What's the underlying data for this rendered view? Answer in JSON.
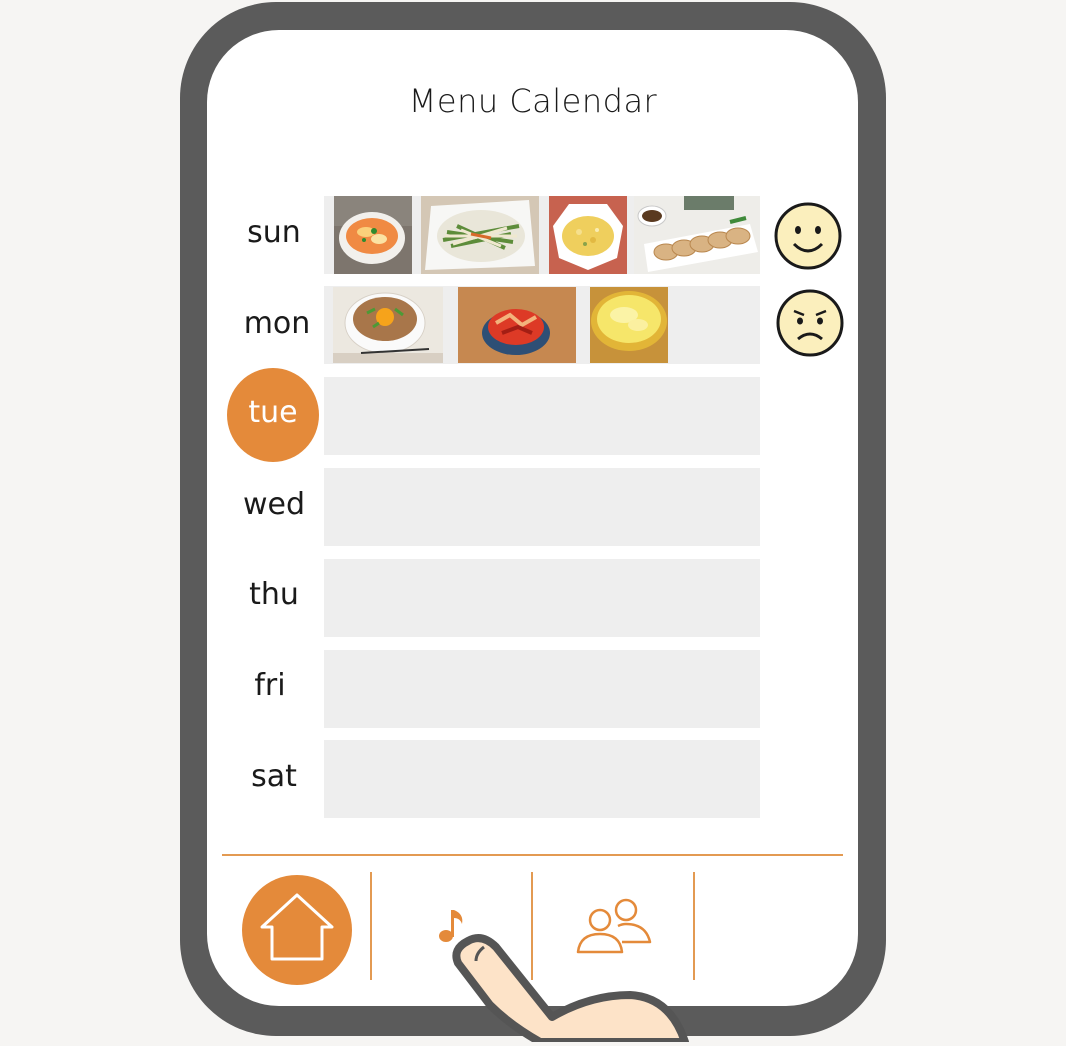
{
  "app": {
    "title": "Menu Calendar"
  },
  "days": [
    {
      "label": "sun",
      "selected": false,
      "foods": [
        "egg-soup",
        "stir-fried-bean-sprouts",
        "fried-rice",
        "gyoza"
      ],
      "rating": "happy"
    },
    {
      "label": "mon",
      "selected": false,
      "foods": [
        "rice-bowl-with-egg",
        "spicy-stir-fry",
        "corn-soup"
      ],
      "rating": "sad"
    },
    {
      "label": "tue",
      "selected": true,
      "foods": [],
      "rating": null
    },
    {
      "label": "wed",
      "selected": false,
      "foods": [],
      "rating": null
    },
    {
      "label": "thu",
      "selected": false,
      "foods": [],
      "rating": null
    },
    {
      "label": "fri",
      "selected": false,
      "foods": [],
      "rating": null
    },
    {
      "label": "sat",
      "selected": false,
      "foods": [],
      "rating": null
    }
  ],
  "nav": {
    "items": [
      {
        "icon": "home-icon",
        "active": true
      },
      {
        "icon": "music-note-icon",
        "active": false
      },
      {
        "icon": "people-icon",
        "active": false
      },
      {
        "icon": "empty-slot",
        "active": false
      }
    ]
  },
  "colors": {
    "accent": "#e48a3a",
    "frame": "#5b5b5b",
    "row_empty": "#eeeeee",
    "face_fill": "#fbefbd"
  }
}
